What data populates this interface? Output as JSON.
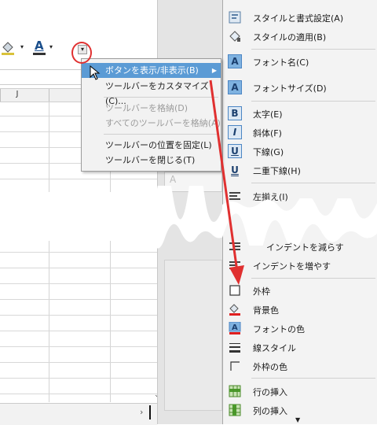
{
  "sheet": {
    "column_header": "J"
  },
  "toolbar": {
    "font_color_glyph": "A",
    "dropdown_glyph": "▾"
  },
  "context_menu": {
    "items": [
      {
        "label": "ボタンを表示/非表示(B)",
        "highlighted": true,
        "submenu": true
      },
      {
        "label": "ツールバーをカスタマイズ(C)...",
        "highlighted": false
      },
      {
        "label": "ツールバーを格納(D)",
        "disabled": true
      },
      {
        "label": "すべてのツールバーを格納(A)",
        "disabled": true
      },
      {
        "label": "ツールバーの位置を固定(L)"
      },
      {
        "label": "ツールバーを閉じる(T)"
      }
    ]
  },
  "right_menu": {
    "items": [
      {
        "label": "スタイルと書式設定(A)",
        "icon": "styles-icon"
      },
      {
        "label": "スタイルの適用(B)",
        "icon": "apply-style-icon"
      },
      {
        "label": "フォント名(C)",
        "icon": "font-name-icon"
      },
      {
        "label": "フォントサイズ(D)",
        "icon": "font-size-icon"
      },
      {
        "label": "太字(E)",
        "icon": "bold-icon"
      },
      {
        "label": "斜体(F)",
        "icon": "italic-icon"
      },
      {
        "label": "下線(G)",
        "icon": "underline-icon"
      },
      {
        "label": "二重下線(H)",
        "icon": "double-underline-icon"
      },
      {
        "label": "左揃え(I)",
        "icon": "align-left-icon"
      },
      {
        "label": "インデントを減らす",
        "icon": "decrease-indent-icon"
      },
      {
        "label": "インデントを増やす",
        "icon": "increase-indent-icon"
      },
      {
        "label": "外枠",
        "icon": "border-icon"
      },
      {
        "label": "背景色",
        "icon": "background-color-icon"
      },
      {
        "label": "フォントの色",
        "icon": "font-color-icon"
      },
      {
        "label": "線スタイル",
        "icon": "line-style-icon"
      },
      {
        "label": "外枠の色",
        "icon": "border-color-icon"
      },
      {
        "label": "行の挿入",
        "icon": "insert-row-icon"
      },
      {
        "label": "列の挿入",
        "icon": "insert-column-icon"
      }
    ]
  },
  "colors": {
    "highlight": "#5b9bd5",
    "annotation_red": "#e03030",
    "menu_bg": "#f3f3f3"
  }
}
